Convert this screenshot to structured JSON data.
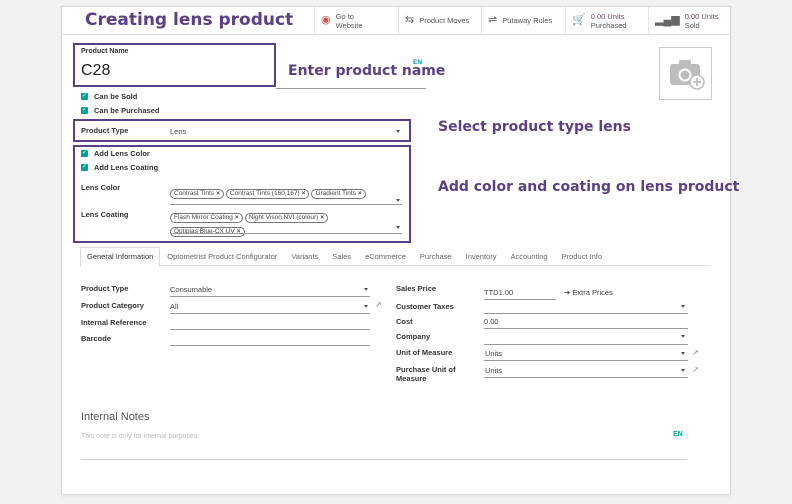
{
  "title": "Creating lens product",
  "smart_buttons": [
    {
      "icon": "globe-icon",
      "line1": "Go to",
      "line2": "Website"
    },
    {
      "icon": "arrows-icon",
      "line1": "Product Moves"
    },
    {
      "icon": "shuffle-icon",
      "line1": "Putaway Rules"
    },
    {
      "icon": "cart-icon",
      "line1": "0.00 Units",
      "line2": "Purchased"
    },
    {
      "icon": "bars-icon",
      "line1": "0.00 Units",
      "line2": "Sold"
    }
  ],
  "annotations": {
    "name": "Enter product name",
    "type": "Select product type lens",
    "color": "Add color and coating on lens product"
  },
  "product": {
    "name_label": "Product Name",
    "name_value": "C28",
    "lang": "EN",
    "can_be_sold": "Can be Sold",
    "can_be_purchased": "Can be Purchased",
    "type_label": "Product Type",
    "type_value": "Lens",
    "add_lens_color": "Add Lens Color",
    "add_lens_coating": "Add Lens Coating",
    "lens_color_label": "Lens Color",
    "lens_color_tags": [
      "Contrast Tints",
      "Contrast Tints (160,167)",
      "Gradient Tints"
    ],
    "lens_coating_label": "Lens Coating",
    "lens_coating_tags": [
      "Flash Mirror Coating",
      "Night Vison NVI (colour)",
      "Optiplas Blue-CX UV"
    ]
  },
  "tabs": [
    "General Information",
    "Optometrist Product Configurator",
    "Variants",
    "Sales",
    "eCommerce",
    "Purchase",
    "Inventory",
    "Accounting",
    "Product Info"
  ],
  "general": {
    "product_type_label": "Product Type",
    "product_type_value": "Consumable",
    "category_label": "Product Category",
    "category_value": "All",
    "internal_ref_label": "Internal Reference",
    "barcode_label": "Barcode",
    "sales_price_label": "Sales Price",
    "sales_price_value": "TTD1.00",
    "extra_prices": "Extra Prices",
    "customer_taxes_label": "Customer Taxes",
    "cost_label": "Cost",
    "cost_value": "0.00",
    "company_label": "Company",
    "uom_label": "Unit of Measure",
    "uom_value": "Units",
    "purchase_uom_label_1": "Purchase Unit of",
    "purchase_uom_label_2": "Measure",
    "purchase_uom_value": "Units"
  },
  "notes": {
    "heading": "Internal Notes",
    "placeholder": "This note is only for internal purposes.",
    "lang": "EN"
  }
}
